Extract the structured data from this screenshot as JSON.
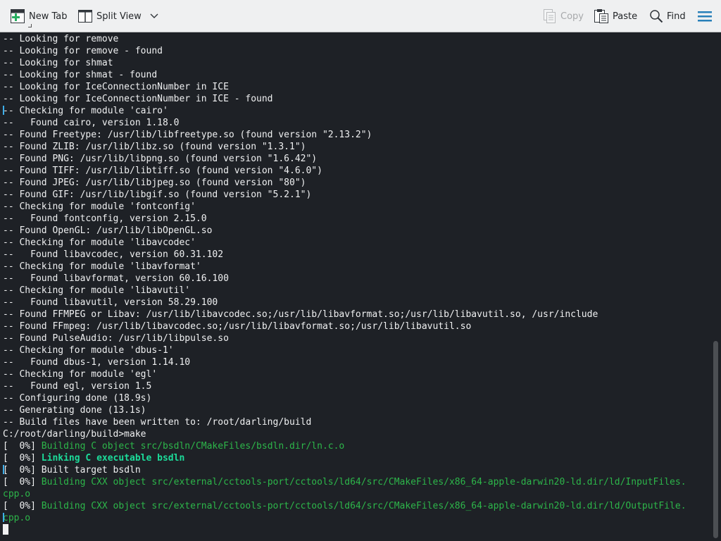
{
  "toolbar": {
    "new_tab": "New Tab",
    "split_view": "Split View",
    "copy": "Copy",
    "paste": "Paste",
    "find": "Find"
  },
  "terminal": {
    "lines": [
      {
        "text": "-- Looking for remove",
        "style": ""
      },
      {
        "text": "-- Looking for remove - found",
        "style": ""
      },
      {
        "text": "-- Looking for shmat",
        "style": ""
      },
      {
        "text": "-- Looking for shmat - found",
        "style": ""
      },
      {
        "text": "-- Looking for IceConnectionNumber in ICE",
        "style": ""
      },
      {
        "text": "-- Looking for IceConnectionNumber in ICE - found",
        "style": ""
      },
      {
        "text": "-- Checking for module 'cairo'",
        "style": ""
      },
      {
        "text": "--   Found cairo, version 1.18.0",
        "style": ""
      },
      {
        "text": "-- Found Freetype: /usr/lib/libfreetype.so (found version \"2.13.2\")",
        "style": ""
      },
      {
        "text": "-- Found ZLIB: /usr/lib/libz.so (found version \"1.3.1\")",
        "style": ""
      },
      {
        "text": "-- Found PNG: /usr/lib/libpng.so (found version \"1.6.42\")",
        "style": ""
      },
      {
        "text": "-- Found TIFF: /usr/lib/libtiff.so (found version \"4.6.0\")",
        "style": ""
      },
      {
        "text": "-- Found JPEG: /usr/lib/libjpeg.so (found version \"80\")",
        "style": ""
      },
      {
        "text": "-- Found GIF: /usr/lib/libgif.so (found version \"5.2.1\")",
        "style": ""
      },
      {
        "text": "-- Checking for module 'fontconfig'",
        "style": ""
      },
      {
        "text": "--   Found fontconfig, version 2.15.0",
        "style": ""
      },
      {
        "text": "-- Found OpenGL: /usr/lib/libOpenGL.so",
        "style": ""
      },
      {
        "text": "-- Checking for module 'libavcodec'",
        "style": ""
      },
      {
        "text": "--   Found libavcodec, version 60.31.102",
        "style": ""
      },
      {
        "text": "-- Checking for module 'libavformat'",
        "style": ""
      },
      {
        "text": "--   Found libavformat, version 60.16.100",
        "style": ""
      },
      {
        "text": "-- Checking for module 'libavutil'",
        "style": ""
      },
      {
        "text": "--   Found libavutil, version 58.29.100",
        "style": ""
      },
      {
        "text": "-- Found FFMPEG or Libav: /usr/lib/libavcodec.so;/usr/lib/libavformat.so;/usr/lib/libavutil.so, /usr/include",
        "style": ""
      },
      {
        "text": "-- Found FFmpeg: /usr/lib/libavcodec.so;/usr/lib/libavformat.so;/usr/lib/libavutil.so",
        "style": ""
      },
      {
        "text": "-- Found PulseAudio: /usr/lib/libpulse.so",
        "style": ""
      },
      {
        "text": "-- Checking for module 'dbus-1'",
        "style": ""
      },
      {
        "text": "--   Found dbus-1, version 1.14.10",
        "style": ""
      },
      {
        "text": "-- Checking for module 'egl'",
        "style": ""
      },
      {
        "text": "--   Found egl, version 1.5",
        "style": ""
      },
      {
        "text": "-- Configuring done (18.9s)",
        "style": ""
      },
      {
        "text": "-- Generating done (13.1s)",
        "style": ""
      },
      {
        "text": "-- Build files have been written to: /root/darling/build",
        "style": ""
      },
      {
        "text": "C:/root/darling/build>make",
        "style": ""
      },
      {
        "prefix": "[  0%] ",
        "text": "Building C object src/bsdln/CMakeFiles/bsdln.dir/ln.c.o",
        "style": "green-dim"
      },
      {
        "prefix": "[  0%] ",
        "text": "Linking C executable bsdln",
        "style": "bold-green"
      },
      {
        "prefix": "[  0%] ",
        "text": "Built target bsdln",
        "style": ""
      },
      {
        "prefix": "[  0%] ",
        "text": "Building CXX object src/external/cctools-port/cctools/ld64/src/CMakeFiles/x86_64-apple-darwin20-ld.dir/ld/InputFiles.",
        "style": "green-dim"
      },
      {
        "text": "cpp.o",
        "style": "green-dim"
      },
      {
        "prefix": "[  0%] ",
        "text": "Building CXX object src/external/cctools-port/cctools/ld64/src/CMakeFiles/x86_64-apple-darwin20-ld.dir/ld/OutputFile.",
        "style": "green-dim"
      },
      {
        "text": "cpp.o",
        "style": "green-dim"
      }
    ]
  }
}
